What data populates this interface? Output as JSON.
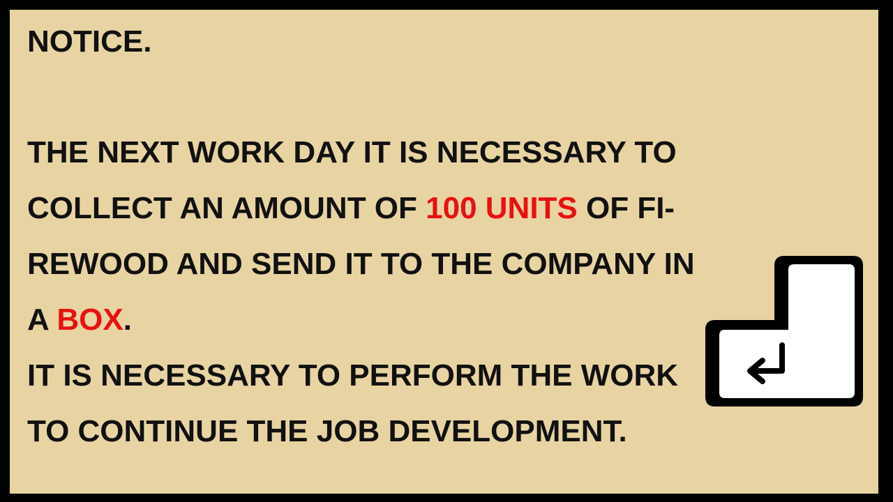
{
  "notice": {
    "title": "NOTICE.",
    "line1": "THE NEXT WORK DAY IT IS NECESSARY TO",
    "line2_a": "COLLECT AN AMOUNT OF ",
    "line2_highlight": "100 UNITS",
    "line2_b": " OF FI-",
    "line3": "REWOOD AND SEND IT TO THE COMPANY IN",
    "line4_a": "A ",
    "line4_highlight": "BOX",
    "line4_b": ".",
    "line5": "IT IS NECESSARY TO PERFORM THE WORK",
    "line6": "TO CONTINUE THE JOB DEVELOPMENT."
  },
  "icons": {
    "continue": "enter-key-icon"
  },
  "colors": {
    "background": "#e8d3a3",
    "border": "#000000",
    "text": "#111111",
    "highlight": "#e8110f"
  }
}
